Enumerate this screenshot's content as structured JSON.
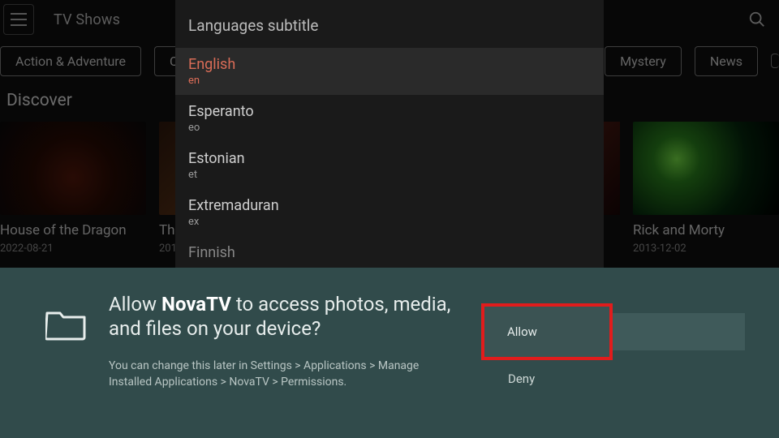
{
  "topbar": {
    "title": "TV Shows"
  },
  "chips": [
    "Action & Adventure",
    "Co",
    "Mystery",
    "News"
  ],
  "section_title": "Discover",
  "cards": [
    {
      "title": "House of the Dragon",
      "date": "2022-08-21"
    },
    {
      "title": "Th",
      "date": "201"
    },
    {
      "title": "",
      "date": ""
    },
    {
      "title": "",
      "date": ""
    },
    {
      "title": "Rick and Morty",
      "date": "2013-12-02"
    }
  ],
  "lang_panel": {
    "header": "Languages subtitle",
    "items": [
      {
        "name": "English",
        "code": "en",
        "selected": true
      },
      {
        "name": "Esperanto",
        "code": "eo",
        "selected": false
      },
      {
        "name": "Estonian",
        "code": "et",
        "selected": false
      },
      {
        "name": "Extremaduran",
        "code": "ex",
        "selected": false
      },
      {
        "name": "Finnish",
        "code": "",
        "selected": false
      }
    ]
  },
  "perm": {
    "prefix": "Allow ",
    "app": "NovaTV",
    "suffix": " to access photos, media, and files on your device?",
    "sub": "You can change this later in Settings > Applications > Manage Installed Applications > NovaTV > Permissions.",
    "allow": "Allow",
    "deny": "Deny"
  }
}
